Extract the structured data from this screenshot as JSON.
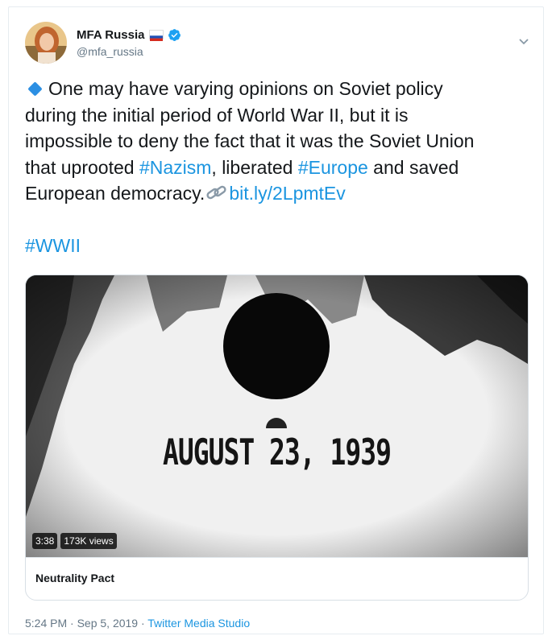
{
  "user": {
    "display_name": "MFA Russia",
    "handle": "@mfa_russia",
    "flag_icon": "russia-flag-icon",
    "verified_icon": "verified-badge-icon"
  },
  "tweet": {
    "line1": "One may have varying opinions on Soviet policy",
    "line2": "during the initial period of World War II, but it is",
    "line3": "impossible to deny the fact that it was the Soviet Union",
    "line4_pre": "that uprooted ",
    "hashtag_nazism": "#Nazism",
    "line4_mid": ", liberated ",
    "hashtag_europe": "#Europe",
    "line4_post": " and saved",
    "line5_pre": "European democracy.",
    "link": "bit.ly/2LpmtEv",
    "hashtag_wwii": "#WWII"
  },
  "media": {
    "video_text": "AUGUST 23, 1939",
    "duration": "3:38",
    "views": "173K views",
    "caption": "Neutrality Pact"
  },
  "meta": {
    "time": "5:24 PM · Sep 5, 2019 · ",
    "source": "Twitter Media Studio"
  },
  "colors": {
    "link": "#1b95e0",
    "text": "#14171a",
    "muted": "#657786"
  }
}
